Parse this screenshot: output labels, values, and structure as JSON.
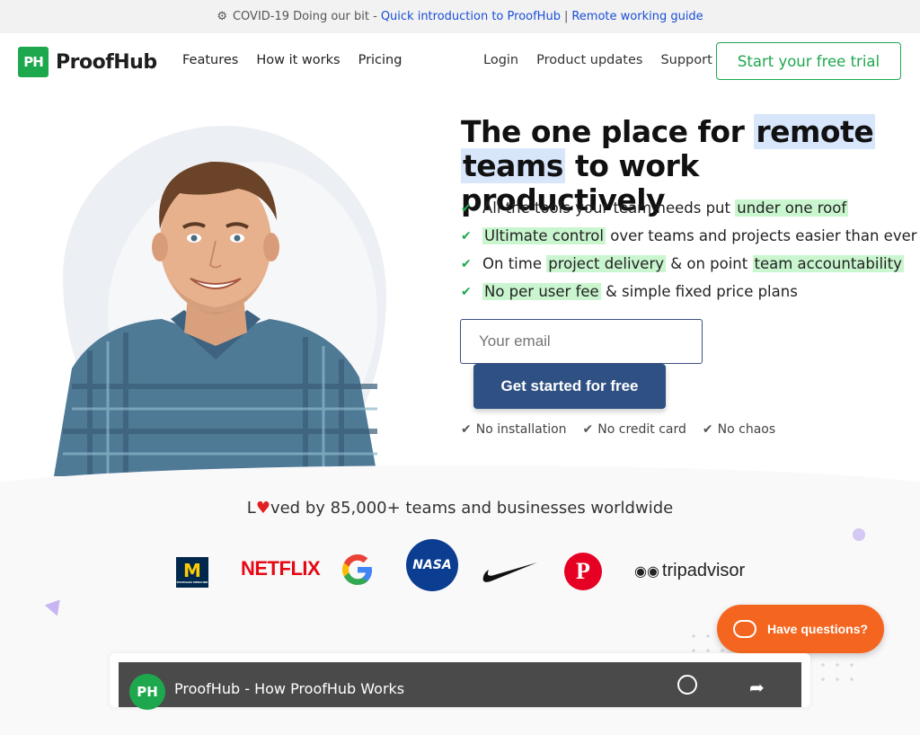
{
  "banner": {
    "icon": "virus-icon",
    "text": "COVID-19 Doing our bit -",
    "link1": "Quick introduction to ProofHub",
    "separator": "|",
    "link2": "Remote working guide"
  },
  "header": {
    "logo_mark": "PH",
    "logo_text": "ProofHub",
    "nav_left": [
      "Features",
      "How it works",
      "Pricing"
    ],
    "nav_right": [
      "Login",
      "Product updates",
      "Support"
    ],
    "trial_button": "Start your free trial"
  },
  "hero": {
    "headline": {
      "part1": "The one place for",
      "highlight1": "remote",
      "highlight2": "teams",
      "part2": "to work productively"
    },
    "features": [
      {
        "pre": "All the tools your team needs put",
        "hl": "under one roof",
        "mid": "",
        "hl2": "",
        "post": ""
      },
      {
        "pre": "",
        "hl": "Ultimate control",
        "mid": "over teams and projects easier than ever",
        "hl2": "",
        "post": ""
      },
      {
        "pre": "On time",
        "hl": "project delivery",
        "mid": "& on point",
        "hl2": "team accountability",
        "post": ""
      },
      {
        "pre": "",
        "hl": "No per user fee",
        "mid": "& simple fixed price plans",
        "hl2": "",
        "post": ""
      }
    ],
    "email_placeholder": "Your email",
    "cta": "Get started for free",
    "perks": [
      "No installation",
      "No credit card",
      "No chaos"
    ]
  },
  "social_proof": {
    "loved_prefix": "L",
    "loved_suffix": "ved by 85,000+ teams and businesses worldwide",
    "logos": {
      "umich": "M",
      "umich_sub": "MICHIGAN MEDICINE",
      "netflix": "NETFLIX",
      "google": "G",
      "nasa": "NASA",
      "pinterest": "P",
      "tripadvisor": "tripadvisor"
    }
  },
  "chat": {
    "label": "Have questions?"
  },
  "video": {
    "logo": "PH",
    "title": "ProofHub - How ProofHub Works"
  },
  "colors": {
    "brand_green": "#1ea84e",
    "cta_blue": "#2f5082",
    "chat_orange": "#f46620",
    "highlight_green": "#c9f5cf",
    "highlight_blue": "#d8e6fb"
  }
}
